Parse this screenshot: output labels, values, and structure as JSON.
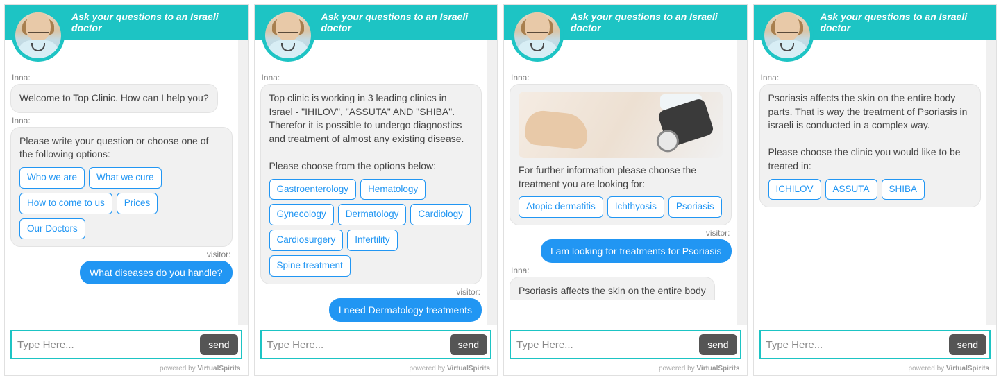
{
  "header_title": "Ask your questions to an Israeli doctor",
  "sender_bot": "Inna:",
  "sender_visitor": "visitor:",
  "input_placeholder": "Type Here...",
  "send_label": "send",
  "footer_powered": "powered  by",
  "footer_brand": "VirtualSpirits",
  "panel1": {
    "msg1": "Welcome to Top Clinic. How can I help you?",
    "msg2_text": "Please write your question or choose one of the following options:",
    "chips": [
      "Who we are",
      "What we cure",
      "How to come to us",
      "Prices",
      "Our Doctors"
    ],
    "user_msg": "What diseases do you handle?"
  },
  "panel2": {
    "msg1_text": "Top clinic is working in 3 leading clinics in Israel - \"IHILOV\", \"ASSUTA\" AND \"SHIBA\". Therefor it is possible to undergo diagnostics and treatment of almost any existing disease.",
    "msg1_prompt": "Please choose from the options below:",
    "chips": [
      "Gastroenterology",
      "Hematology",
      "Gynecology",
      "Dermatology",
      "Cardiology",
      "Cardiosurgery",
      "Infertility",
      "Spine treatment"
    ],
    "user_msg": "I need Dermatology treatments"
  },
  "panel3": {
    "msg1_text": "For further information please choose the treatment you are looking for:",
    "chips": [
      "Atopic dermatitis",
      "Ichthyosis",
      "Psoriasis"
    ],
    "user_msg": "I am looking for treatments for Psoriasis",
    "msg2_partial": "Psoriasis affects the skin on the entire body"
  },
  "panel4": {
    "msg1_text": "Psoriasis affects the skin on the entire body parts. That is way the treatment of Psoriasis in israeli is conducted in a complex way.",
    "msg1_prompt": "Please choose the clinic you would like to be treated in:",
    "chips": [
      "ICHILOV",
      "ASSUTA",
      "SHIBA"
    ]
  }
}
